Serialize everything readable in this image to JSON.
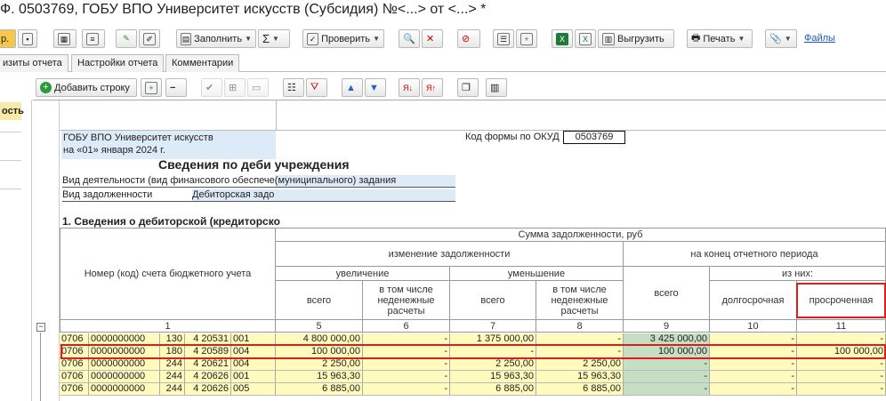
{
  "window": {
    "title": "Ф. 0503769, ГОБУ ВПО Университет искусств (Субсидия) №<...> от <...> *"
  },
  "toolbar": {
    "fill_label": "Заполнить",
    "check_label": "Проверить",
    "export_label": "Выгрузить",
    "print_label": "Печать",
    "files_label": "Файлы",
    "first_btn_label": "р."
  },
  "tabs": [
    "изиты отчета",
    "Настройки отчета",
    "Комментарии"
  ],
  "toolbar2": {
    "add_row_label": "Добавить строку"
  },
  "leftpanel": {
    "item": "ость"
  },
  "header": {
    "org": "ГОБУ ВПО Университет искусств",
    "date": "на «01» января 2024 г.",
    "okud_label": "Код формы по ОКУД",
    "okud_value": "0503769",
    "report_title": "Сведения по деби учреждения",
    "activity_label": "Вид деятельности (вид финансового обеспече",
    "activity_value": "(муниципального) задания",
    "debt_label": "Вид задолженности",
    "debt_value": "Дебиторская задо",
    "section_title": "1. Сведения о дебиторской (кредиторско"
  },
  "table": {
    "h_sum": "Сумма задолженности, руб",
    "h_change": "изменение задолженности",
    "h_end": "на конец отчетного периода",
    "h_account": "Номер (код) счета бюджетного учета",
    "h_increase": "увеличение",
    "h_decrease": "уменьшение",
    "h_of_them": "из них:",
    "h_total": "всего",
    "h_nonmonetary": "в том числе неденежные расчеты",
    "h_longterm": "долгосрочная",
    "h_overdue": "просроченная",
    "col_nums": [
      "1",
      "5",
      "6",
      "7",
      "8",
      "9",
      "10",
      "11"
    ],
    "rows": [
      {
        "c1": "0706",
        "c2": "0000000000",
        "c3": "130",
        "c4": "4 20531",
        "c5": "001",
        "v5": "4 800 000,00",
        "v6": "-",
        "v7": "1 375 000,00",
        "v8": "-",
        "v9": "3 425 000,00",
        "v10": "-",
        "v11": "-"
      },
      {
        "c1": "0706",
        "c2": "0000000000",
        "c3": "180",
        "c4": "4 20589",
        "c5": "004",
        "v5": "100 000,00",
        "v6": "-",
        "v7": "-",
        "v8": "-",
        "v9": "100 000,00",
        "v10": "-",
        "v11": "100 000,00"
      },
      {
        "c1": "0706",
        "c2": "0000000000",
        "c3": "244",
        "c4": "4 20621",
        "c5": "004",
        "v5": "2 250,00",
        "v6": "-",
        "v7": "2 250,00",
        "v8": "2 250,00",
        "v9": "-",
        "v10": "-",
        "v11": "-"
      },
      {
        "c1": "0706",
        "c2": "0000000000",
        "c3": "244",
        "c4": "4 20626",
        "c5": "001",
        "v5": "15 963,30",
        "v6": "-",
        "v7": "15 963,30",
        "v8": "15 963,30",
        "v9": "-",
        "v10": "-",
        "v11": "-"
      },
      {
        "c1": "0706",
        "c2": "0000000000",
        "c3": "244",
        "c4": "4 20626",
        "c5": "005",
        "v5": "6 885,00",
        "v6": "-",
        "v7": "6 885,00",
        "v8": "6 885,00",
        "v9": "-",
        "v10": "-",
        "v11": "-"
      }
    ]
  },
  "colors": {
    "highlight": "#e01b1b",
    "yellow": "#fffbbd",
    "blue": "#dcebf7",
    "green": "#c6dfc4"
  }
}
